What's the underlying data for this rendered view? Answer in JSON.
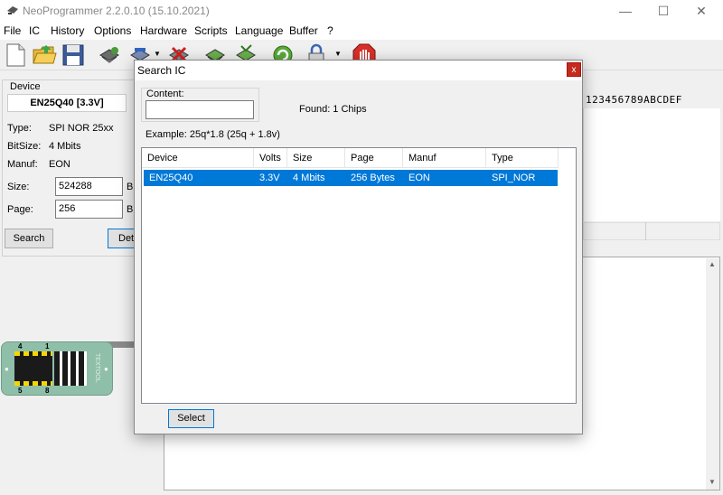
{
  "window": {
    "title": "NeoProgrammer 2.2.0.10 (15.10.2021)",
    "minimize": "—",
    "maximize": "☐",
    "close": "✕"
  },
  "menu": [
    "File",
    "IC",
    "History",
    "Options",
    "Hardware",
    "Scripts",
    "Language",
    "Buffer",
    "?"
  ],
  "device_panel": {
    "group_label": "Device",
    "chip": "EN25Q40 [3.3V]",
    "type_label": "Type:",
    "type_value": "SPI NOR 25xx",
    "bitsize_label": "BitSize:",
    "bitsize_value": "4 Mbits",
    "manuf_label": "Manuf:",
    "manuf_value": "EON",
    "size_label": "Size:",
    "size_value": "524288",
    "size_unit": "B",
    "page_label": "Page:",
    "page_value": "256",
    "page_unit": "B",
    "search_button": "Search",
    "detect_button": "Det"
  },
  "hex_header": "123456789ABCDEF",
  "adapter": {
    "pin4": "4",
    "pin1": "1",
    "pin5": "5",
    "pin8": "8",
    "brand": "TEXTOOL"
  },
  "dialog": {
    "title": "Search IC",
    "close": "x",
    "content_label": "Content:",
    "content_value": "",
    "found_text": "Found: 1 Chips",
    "example_text": "Example:  25q*1.8 (25q + 1.8v)",
    "columns": [
      "Device",
      "Volts",
      "Size",
      "Page",
      "Manuf",
      "Type"
    ],
    "rows": [
      {
        "device": "EN25Q40",
        "volts": "3.3V",
        "size": "4 Mbits",
        "page": "256 Bytes",
        "manuf": "EON",
        "type": "SPI_NOR"
      }
    ],
    "select_button": "Select"
  },
  "colors": {
    "selection": "#0078d7",
    "close_red": "#c42b1c",
    "adapter_green": "#8fbfa8"
  }
}
